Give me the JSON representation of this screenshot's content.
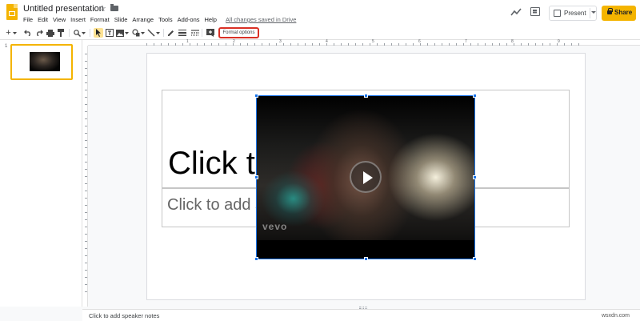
{
  "header": {
    "title": "Untitled presentation",
    "menus": [
      "File",
      "Edit",
      "View",
      "Insert",
      "Format",
      "Slide",
      "Arrange",
      "Tools",
      "Add-ons",
      "Help"
    ],
    "save_status": "All changes saved in Drive",
    "present_label": "Present",
    "share_label": "Share",
    "icons": [
      "star-icon",
      "folder-icon",
      "activity-icon",
      "comments-icon",
      "lock-icon"
    ]
  },
  "toolbar": {
    "format_options_label": "Format options",
    "icons": [
      "new-slide-icon",
      "undo-icon",
      "redo-icon",
      "print-icon",
      "paint-format-icon",
      "zoom-icon",
      "select-cursor-icon",
      "text-box-icon",
      "image-icon",
      "shape-icon",
      "line-icon",
      "pencil-icon",
      "border-weight-icon",
      "border-dash-icon",
      "add-comment-icon"
    ]
  },
  "ruler": {
    "marks": [
      "1",
      "2",
      "3",
      "4",
      "5",
      "6",
      "7",
      "8",
      "9"
    ]
  },
  "filmstrip": {
    "slides": [
      {
        "number": "1"
      }
    ]
  },
  "slide": {
    "title_placeholder": "Click to add title",
    "subtitle_placeholder": "Click to add subtitle",
    "video": {
      "watermark": "vevo"
    }
  },
  "notes": {
    "placeholder": "Click to add speaker notes"
  },
  "watermark": "wsxdn.com",
  "colors": {
    "accent": "#f4b400",
    "selection": "#1a73e8",
    "highlight": "#d93025"
  }
}
